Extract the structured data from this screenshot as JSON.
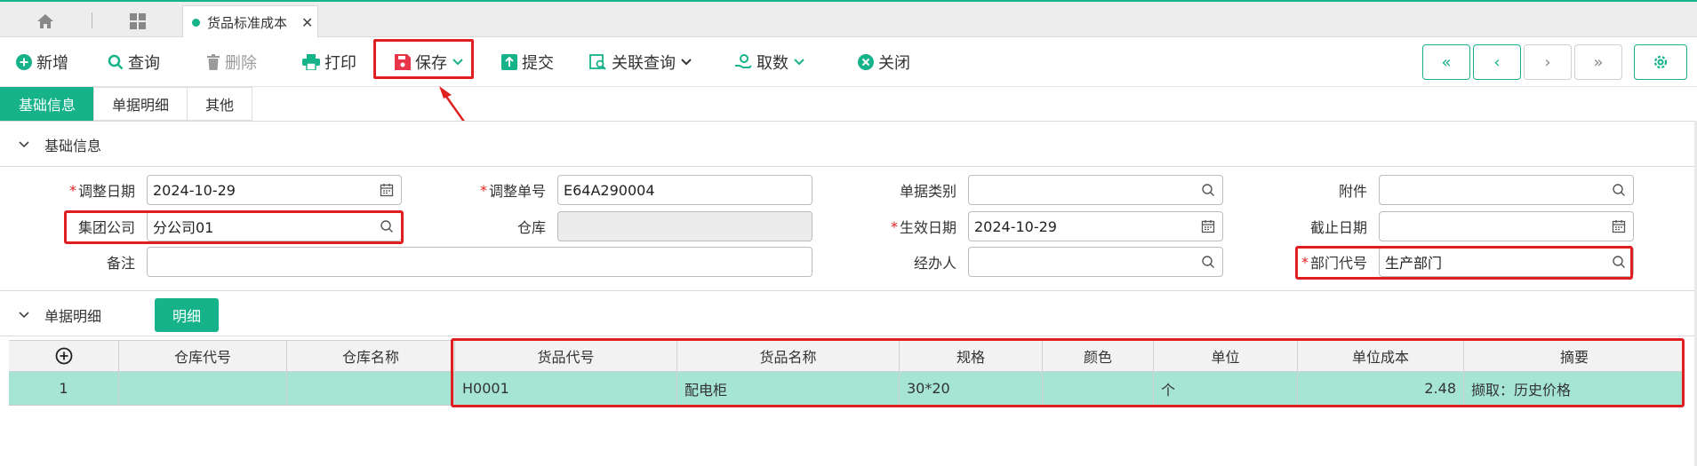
{
  "tabs": {
    "home_icon": "home-icon",
    "grid_icon": "grid-icon",
    "doc_tab_title": "货品标准成本",
    "close_glyph": "✕"
  },
  "toolbar": {
    "add": "新增",
    "query": "查询",
    "delete": "删除",
    "print": "打印",
    "save": "保存",
    "submit": "提交",
    "related_query": "关联查询",
    "fetch": "取数",
    "close": "关闭"
  },
  "nav": {
    "first": "«",
    "prev": "‹",
    "next": "›",
    "last": "»"
  },
  "section_tabs": [
    "基础信息",
    "单据明细",
    "其他"
  ],
  "basic_section": {
    "title": "基础信息"
  },
  "form": {
    "adjust_date_label": "调整日期",
    "adjust_date_value": "2024-10-29",
    "adjust_no_label": "调整单号",
    "adjust_no_value": "E64A290004",
    "doc_type_label": "单据类别",
    "doc_type_value": "",
    "attachment_label": "附件",
    "attachment_value": "",
    "group_company_label": "集团公司",
    "group_company_value": "分公司01",
    "warehouse_label": "仓库",
    "warehouse_value": "",
    "effective_date_label": "生效日期",
    "effective_date_value": "2024-10-29",
    "end_date_label": "截止日期",
    "end_date_value": "",
    "remark_label": "备注",
    "remark_value": "",
    "handler_label": "经办人",
    "handler_value": "",
    "dept_code_label": "部门代号",
    "dept_code_value": "生产部门",
    "required_mark": "*"
  },
  "detail_section": {
    "title": "单据明细",
    "detail_button": "明细"
  },
  "grid": {
    "add_glyph": "⊕",
    "columns": [
      "仓库代号",
      "仓库名称",
      "货品代号",
      "货品名称",
      "规格",
      "颜色",
      "单位",
      "单位成本",
      "摘要"
    ],
    "rows": [
      {
        "no": "1",
        "warehouse_code": "",
        "warehouse_name": "",
        "item_code": "H0001",
        "item_name": "配电柜",
        "spec": "30*20",
        "color": "",
        "unit": "个",
        "unit_cost": "2.48",
        "summary": "撷取：历史价格"
      }
    ]
  },
  "colors": {
    "accent": "#16b28a",
    "highlight_row": "#a6e5d3",
    "annotation_red": "#e02020"
  }
}
